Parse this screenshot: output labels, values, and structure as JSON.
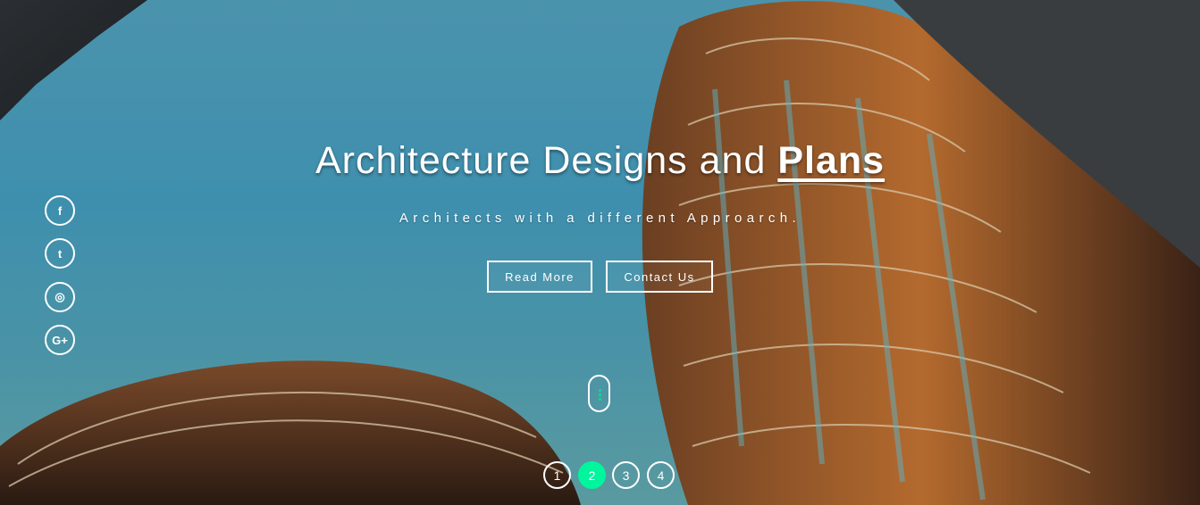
{
  "hero": {
    "title_main": "Architecture Designs and ",
    "title_accent": "Plans",
    "subtitle": "Architects with a different Approarch.",
    "buttons": {
      "read_more": "Read More",
      "contact_us": "Contact Us"
    }
  },
  "social": [
    {
      "icon": "facebook-icon",
      "glyph": "f"
    },
    {
      "icon": "twitter-icon",
      "glyph": "t"
    },
    {
      "icon": "instagram-icon",
      "glyph": "◎"
    },
    {
      "icon": "google-plus-icon",
      "glyph": "G+"
    }
  ],
  "pagination": {
    "pages": [
      "1",
      "2",
      "3",
      "4"
    ],
    "active": "2"
  },
  "colors": {
    "accent": "#00f59c",
    "sky": "#3f8fab",
    "white": "#ffffff"
  }
}
